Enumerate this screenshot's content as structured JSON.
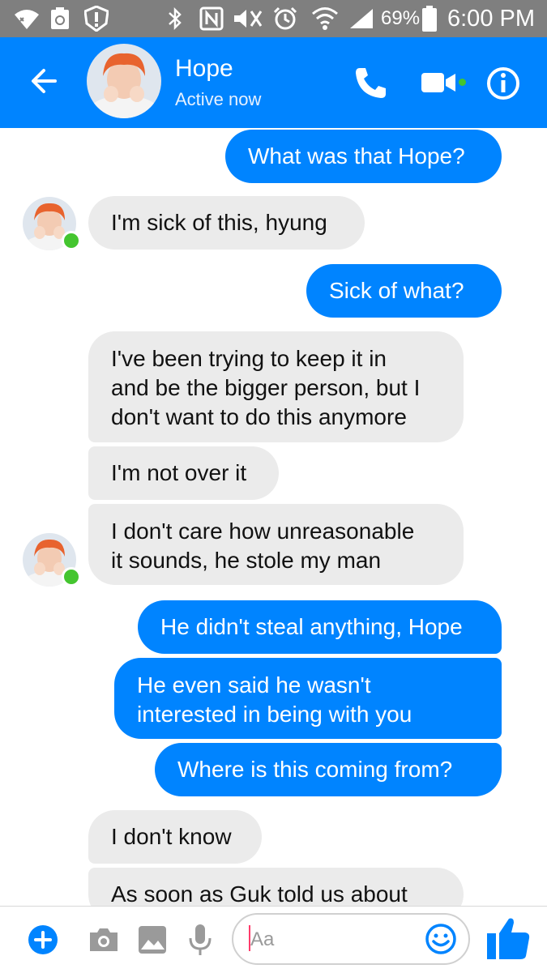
{
  "status_bar": {
    "battery": "69%",
    "time": "6:00 PM"
  },
  "header": {
    "name": "Hope",
    "status": "Active now"
  },
  "messages": [
    {
      "from": "me",
      "text": "What was that Hope?"
    },
    {
      "from": "them",
      "text": "I'm sick of this, hyung"
    },
    {
      "from": "me",
      "text": "Sick of what?"
    },
    {
      "from": "them",
      "lines": [
        "I've been trying to keep it in",
        "and be the bigger person, but I",
        "don't want to do this anymore"
      ]
    },
    {
      "from": "them",
      "text": "I'm not over it"
    },
    {
      "from": "them",
      "lines": [
        "I don't care how unreasonable",
        "it sounds, he stole my man"
      ]
    },
    {
      "from": "me",
      "text": "He didn't steal anything, Hope"
    },
    {
      "from": "me",
      "lines": [
        "He even said he wasn't",
        "interested in being with you"
      ]
    },
    {
      "from": "me",
      "text": "Where is this coming from?"
    },
    {
      "from": "them",
      "text": "I don't know"
    },
    {
      "from": "them",
      "text": "As soon as Guk told us about"
    }
  ],
  "composer": {
    "placeholder": "Aa"
  },
  "colors": {
    "brand": "#0084ff",
    "incoming": "#ebebeb",
    "active_dot": "#44c52f",
    "status_bar": "#7f7f7f"
  },
  "icons": [
    "wifi-calling-icon",
    "recycle-icon",
    "alert-shield-icon",
    "bluetooth-icon",
    "nfc-icon",
    "mute-icon",
    "alarm-icon",
    "wifi-icon",
    "signal-icon",
    "battery-icon",
    "back-arrow-icon",
    "phone-icon",
    "video-camera-icon",
    "info-icon",
    "plus-icon",
    "camera-icon",
    "image-icon",
    "microphone-icon",
    "emoji-icon",
    "like-icon"
  ]
}
